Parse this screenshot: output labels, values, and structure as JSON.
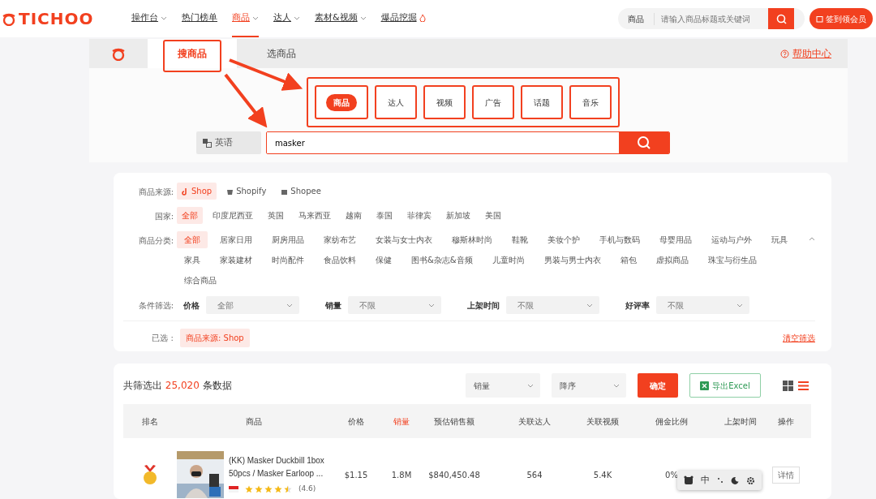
{
  "header": {
    "logo": "TICHOO",
    "nav": [
      {
        "label": "操作台",
        "dropdown": true,
        "hot": false,
        "selected": false
      },
      {
        "label": "热门榜单",
        "dropdown": false,
        "hot": false,
        "selected": false
      },
      {
        "label": "商品",
        "dropdown": true,
        "hot": false,
        "selected": true
      },
      {
        "label": "达人",
        "dropdown": true,
        "hot": false,
        "selected": false
      },
      {
        "label": "素材&视频",
        "dropdown": true,
        "hot": false,
        "selected": false
      },
      {
        "label": "爆品挖掘",
        "dropdown": false,
        "hot": true,
        "selected": false
      }
    ],
    "search_scope": "商品",
    "search_placeholder": "请输入商品标题或关键词",
    "member_button": "签到领会员"
  },
  "tabs": [
    {
      "label": "搜商品",
      "selected": true
    },
    {
      "label": "选商品",
      "selected": false
    }
  ],
  "help": "帮助中心",
  "search_types": [
    {
      "label": "商品",
      "selected": true
    },
    {
      "label": "达人",
      "selected": false
    },
    {
      "label": "视频",
      "selected": false
    },
    {
      "label": "广告",
      "selected": false
    },
    {
      "label": "话题",
      "selected": false
    },
    {
      "label": "音乐",
      "selected": false
    }
  ],
  "language": "英语",
  "query": "masker",
  "filter_rows": [
    {
      "label": "商品来源:",
      "options": [
        {
          "label": "Shop",
          "kind": "tiktok",
          "selected": true
        },
        {
          "label": "Shopify",
          "kind": "shopify",
          "selected": false
        },
        {
          "label": "Shopee",
          "kind": "shopee",
          "selected": false
        }
      ]
    },
    {
      "label": "国家:",
      "options": [
        {
          "label": "全部",
          "selected": true
        },
        {
          "label": "印度尼西亚",
          "selected": false
        },
        {
          "label": "英国",
          "selected": false
        },
        {
          "label": "马来西亚",
          "selected": false
        },
        {
          "label": "越南",
          "selected": false
        },
        {
          "label": "泰国",
          "selected": false
        },
        {
          "label": "菲律宾",
          "selected": false
        },
        {
          "label": "新加坡",
          "selected": false
        },
        {
          "label": "美国",
          "selected": false
        }
      ]
    },
    {
      "label": "商品分类:",
      "expanded": true,
      "options": [
        {
          "label": "全部",
          "selected": true
        },
        {
          "label": "居家日用",
          "selected": false
        },
        {
          "label": "厨房用品",
          "selected": false
        },
        {
          "label": "家纺布艺",
          "selected": false
        },
        {
          "label": "女装与女士内衣",
          "selected": false
        },
        {
          "label": "穆斯林时尚",
          "selected": false
        },
        {
          "label": "鞋靴",
          "selected": false
        },
        {
          "label": "美妆个护",
          "selected": false
        },
        {
          "label": "手机与数码",
          "selected": false
        },
        {
          "label": "母婴用品",
          "selected": false
        },
        {
          "label": "运动与户外",
          "selected": false
        },
        {
          "label": "玩具",
          "selected": false
        },
        {
          "label": "家具",
          "selected": false
        },
        {
          "label": "家装建材",
          "selected": false
        },
        {
          "label": "时尚配件",
          "selected": false
        },
        {
          "label": "食品饮料",
          "selected": false
        },
        {
          "label": "保健",
          "selected": false
        },
        {
          "label": "图书&杂志&音频",
          "selected": false
        },
        {
          "label": "儿童时尚",
          "selected": false
        },
        {
          "label": "男装与男士内衣",
          "selected": false
        },
        {
          "label": "箱包",
          "selected": false
        },
        {
          "label": "虚拟商品",
          "selected": false
        },
        {
          "label": "珠宝与衍生品",
          "selected": false
        },
        {
          "label": "综合商品",
          "selected": false
        }
      ]
    }
  ],
  "conditions": {
    "label": "条件筛选:",
    "fields": [
      {
        "name": "价格",
        "value": "全部"
      },
      {
        "name": "销量",
        "value": "不限"
      },
      {
        "name": "上架时间",
        "value": "不限"
      },
      {
        "name": "好评率",
        "value": "不限"
      }
    ]
  },
  "chosen": {
    "label": "已选 :",
    "tags": [
      "商品来源: Shop"
    ],
    "clear": "清空筛选"
  },
  "results": {
    "prefix": "共筛选出",
    "count": "25,020",
    "suffix": "条数据",
    "sort_field": "销量",
    "sort_order": "降序",
    "confirm": "确定",
    "export": "导出Excel",
    "views": [
      {
        "kind": "grid",
        "selected": false
      },
      {
        "kind": "list",
        "selected": true
      }
    ],
    "columns": [
      {
        "label": "排名",
        "sorted": false
      },
      {
        "label": "商品",
        "sorted": false
      },
      {
        "label": "价格",
        "sorted": false
      },
      {
        "label": "销量",
        "sorted": true
      },
      {
        "label": "预估销售额",
        "sorted": false
      },
      {
        "label": "关联达人",
        "sorted": false
      },
      {
        "label": "关联视频",
        "sorted": false
      },
      {
        "label": "佣金比例",
        "sorted": false
      },
      {
        "label": "上架时间",
        "sorted": false
      },
      {
        "label": "操作",
        "sorted": false
      }
    ],
    "rows": [
      {
        "name": "(KK) Masker Duckbill 1box 50pcs / Masker Earloop ...",
        "stars": 4.5,
        "rating": "(4.6)",
        "price": "$1.15",
        "sales": "1.8M",
        "revenue": "$840,450.48",
        "creators": "564",
        "videos": "5.4K",
        "commission": "0%",
        "action": "详情"
      }
    ]
  },
  "ime": {
    "mode": "中"
  }
}
